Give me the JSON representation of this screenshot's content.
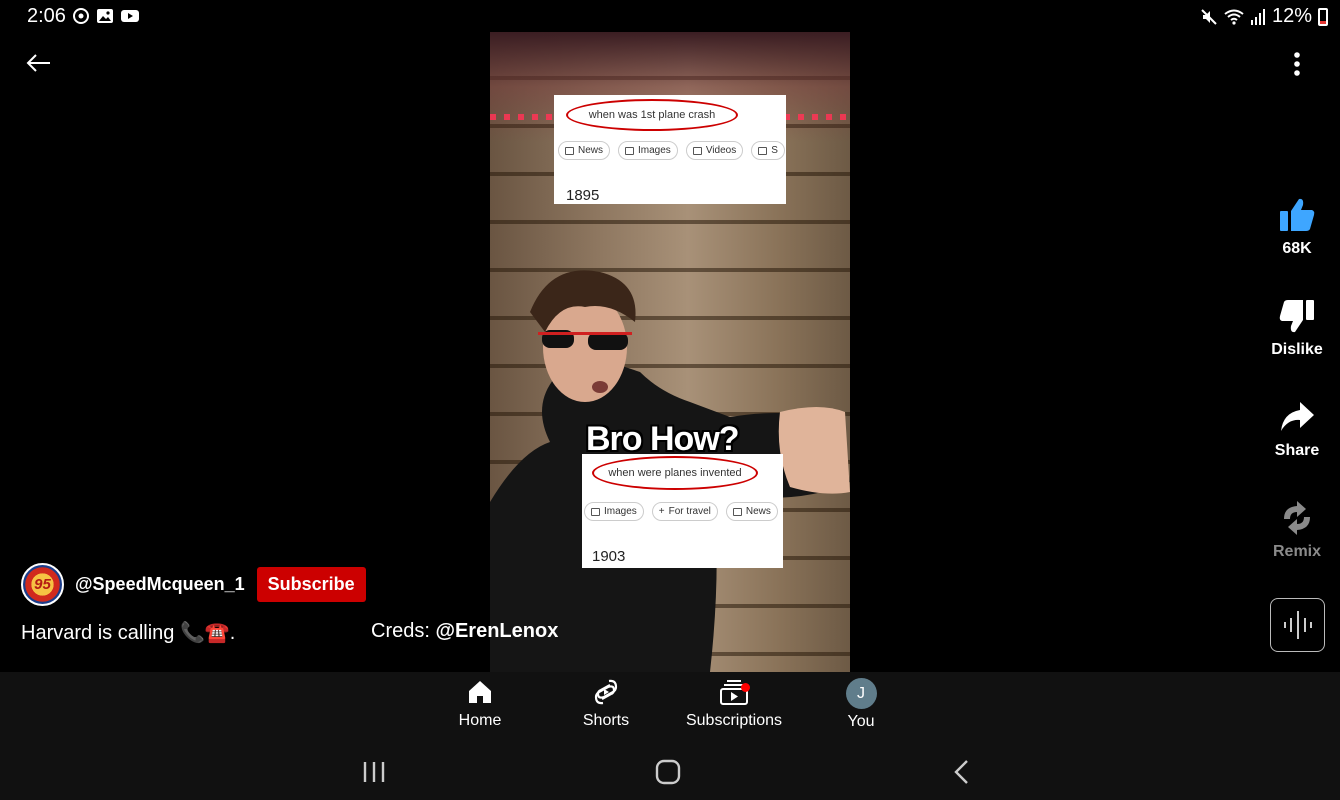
{
  "status_bar": {
    "time": "2:06",
    "battery": "12%",
    "left_icons": [
      "data-saver-icon",
      "gallery-icon",
      "youtube-icon"
    ],
    "right_icons": [
      "mute-icon",
      "wifi-icon",
      "signal-icon",
      "battery-icon"
    ]
  },
  "video": {
    "overlay_caption": "Bro How?",
    "card1": {
      "query": "when was 1st plane crash",
      "chips": [
        "News",
        "Images",
        "Videos",
        "S"
      ],
      "result": "1895"
    },
    "card2": {
      "query": "when were planes invented",
      "chips": [
        "Images",
        "For travel",
        "News"
      ],
      "result": "1903"
    }
  },
  "actions": {
    "like_count": "68K",
    "dislike_label": "Dislike",
    "share_label": "Share",
    "remix_label": "Remix"
  },
  "channel": {
    "avatar_text": "95",
    "handle": "@SpeedMcqueen_1",
    "subscribe_label": "Subscribe"
  },
  "description": {
    "text": "Harvard is calling 📞☎️.",
    "creds_prefix": "Creds: ",
    "creds_handle": "@ErenLenox"
  },
  "bottom_nav": {
    "home": "Home",
    "shorts": "Shorts",
    "subscriptions": "Subscriptions",
    "you": "You",
    "you_initial": "J"
  },
  "colors": {
    "subscribe": "#cc0000",
    "like_accent": "#3ea6ff",
    "background": "#000000"
  }
}
